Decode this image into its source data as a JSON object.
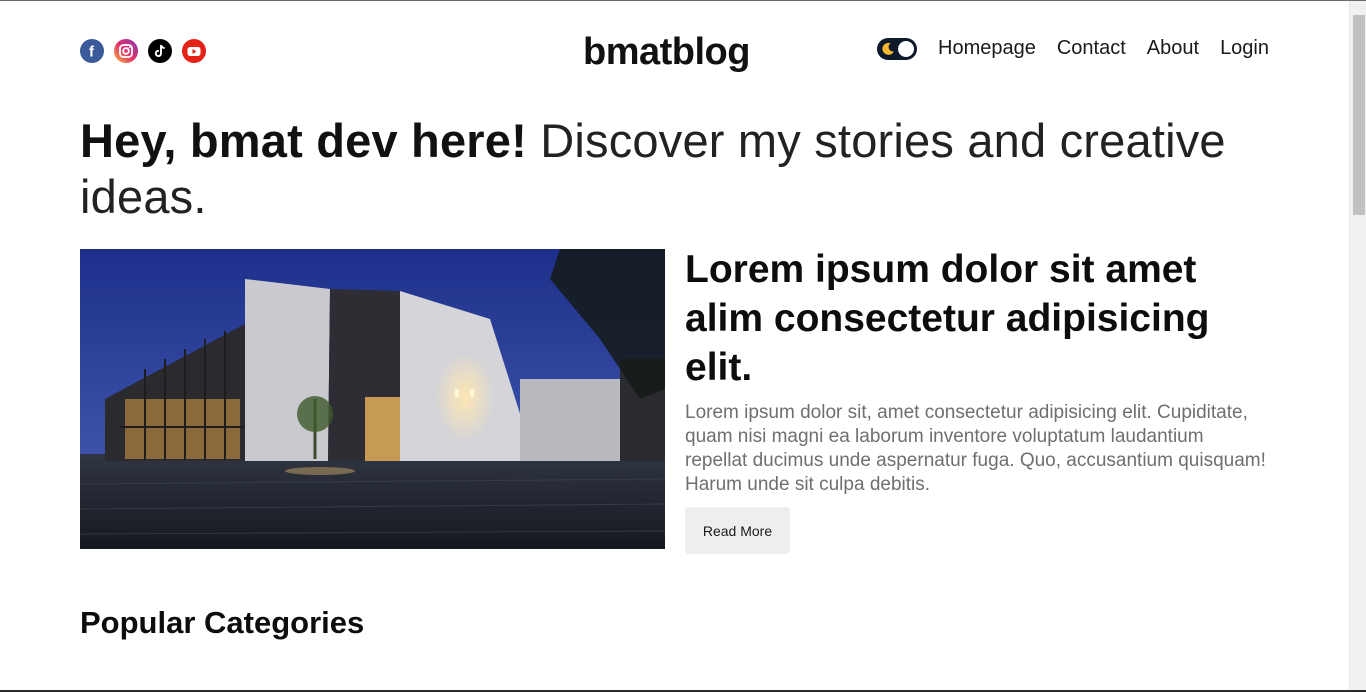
{
  "header": {
    "brand": "bmatblog",
    "socials": [
      {
        "name": "facebook",
        "icon": "facebook-icon",
        "color": "#3b5a9a"
      },
      {
        "name": "instagram",
        "icon": "instagram-icon",
        "color": "#e1306c"
      },
      {
        "name": "tiktok",
        "icon": "tiktok-icon",
        "color": "#000000"
      },
      {
        "name": "youtube",
        "icon": "youtube-icon",
        "color": "#e62117"
      }
    ],
    "theme_toggle": {
      "icon": "moon-icon",
      "state": "dark"
    },
    "nav": {
      "homepage": "Homepage",
      "contact": "Contact",
      "about": "About",
      "login": "Login"
    }
  },
  "hero": {
    "bold": "Hey, bmat dev here!",
    "light": "Discover my stories and creative ideas."
  },
  "featured": {
    "image_icon": "building-photo",
    "title": "Lorem ipsum dolor sit amet alim consectetur adipisicing elit.",
    "description": "Lorem ipsum dolor sit, amet consectetur adipisicing elit. Cupiditate, quam nisi magni ea laborum inventore voluptatum laudantium repellat ducimus unde aspernatur fuga. Quo, accusantium quisquam! Harum unde sit culpa debitis.",
    "button": "Read More"
  },
  "categories": {
    "title": "Popular Categories"
  },
  "colors": {
    "accent_dark": "#0e1a2b",
    "moon": "#f5b82e",
    "button_bg": "#eeeeee",
    "muted_text": "#6f6f6f"
  }
}
